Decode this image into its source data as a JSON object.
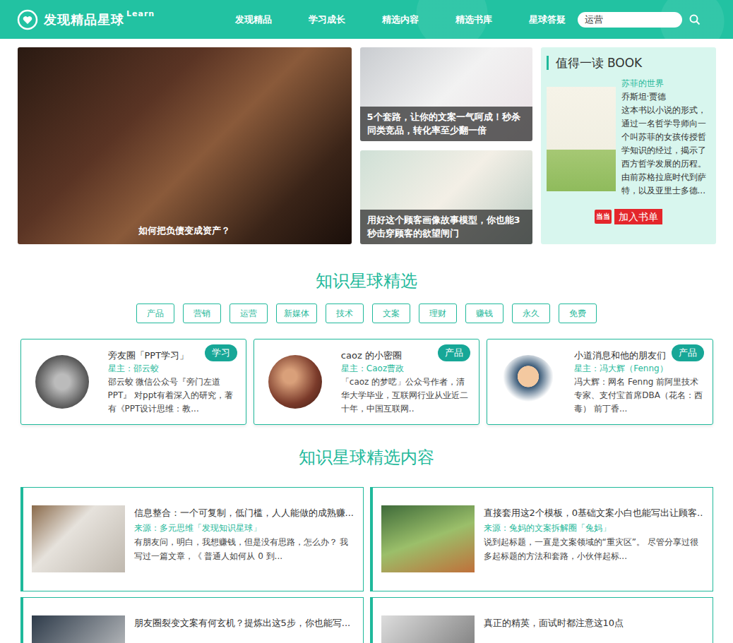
{
  "header": {
    "logo": {
      "title": "发现精品星球",
      "sup": "Learn"
    },
    "nav": [
      {
        "label": "发现精品"
      },
      {
        "label": "学习成长"
      },
      {
        "label": "精选内容"
      },
      {
        "label": "精选书库"
      },
      {
        "label": "星球答疑"
      }
    ],
    "search": {
      "value": "运营"
    }
  },
  "hero": {
    "main": {
      "caption": "如何把负债变成资产？"
    },
    "side": [
      {
        "caption": "5个套路，让你的文案一气呵成！秒杀同类竞品，转化率至少翻一倍"
      },
      {
        "caption": "用好这个顾客画像故事模型，你也能3秒击穿顾客的欲望闸门"
      }
    ]
  },
  "book": {
    "heading": "值得一读 BOOK",
    "title": "苏菲的世界",
    "author": "乔斯坦·贾德",
    "description": "这本书以小说的形式，通过一名哲学导师向一个叫苏菲的女孩传授哲学知识的经过，揭示了西方哲学发展的历程。由前苏格拉底时代到萨特，以及亚里士多德...",
    "store": "当当",
    "button": "加入书单"
  },
  "planets": {
    "title": "知识星球精选",
    "tags": [
      "产品",
      "营销",
      "运营",
      "新媒体",
      "技术",
      "文案",
      "理财",
      "赚钱",
      "永久",
      "免费"
    ],
    "cards": [
      {
        "name": "旁友圈「PPT学习」",
        "owner": "星主：邵云蛟",
        "description": "邵云蛟 微信公众号『旁门左道PPT』 对ppt有着深入的研究，著有《PPT设计思维：教...",
        "badge": "学习"
      },
      {
        "name": "caoz 的小密圈",
        "owner": "星主：Caoz曹政",
        "description": "「caoz 的梦呓」公众号作者，清华大学毕业，互联网行业从业近二十年，中国互联网..",
        "badge": "产品"
      },
      {
        "name": "小道消息和他的朋友们",
        "owner": "星主：冯大辉（Fenng）",
        "description": "冯大辉：网名 Fenng 前阿里技术专家、支付宝首席DBA（花名：西毒） 前丁香...",
        "badge": "产品"
      }
    ]
  },
  "articles": {
    "title": "知识星球精选内容",
    "items": [
      {
        "title": "信息整合：一个可复制，低门槛，人人能做的成熟赚...",
        "source": "来源：多元思维「发现知识星球」",
        "excerpt": "有朋友问，明白，我想赚钱，但是没有思路，怎么办？ 我写过一篇文章，《 普通人如何从 0 到..."
      },
      {
        "title": "直接套用这2个模板，0基础文案小白也能写出让顾客..",
        "source": "来源：兔妈的文案拆解圈「兔妈」",
        "excerpt": "说到起标题，一直是文案领域的“重灾区”。 尽管分享过很多起标题的方法和套路，小伙伴起标..."
      },
      {
        "title": "朋友圈裂变文案有何玄机？提炼出这5步，你也能写..."
      },
      {
        "title": "真正的精英，面试时都注意这10点"
      }
    ]
  }
}
